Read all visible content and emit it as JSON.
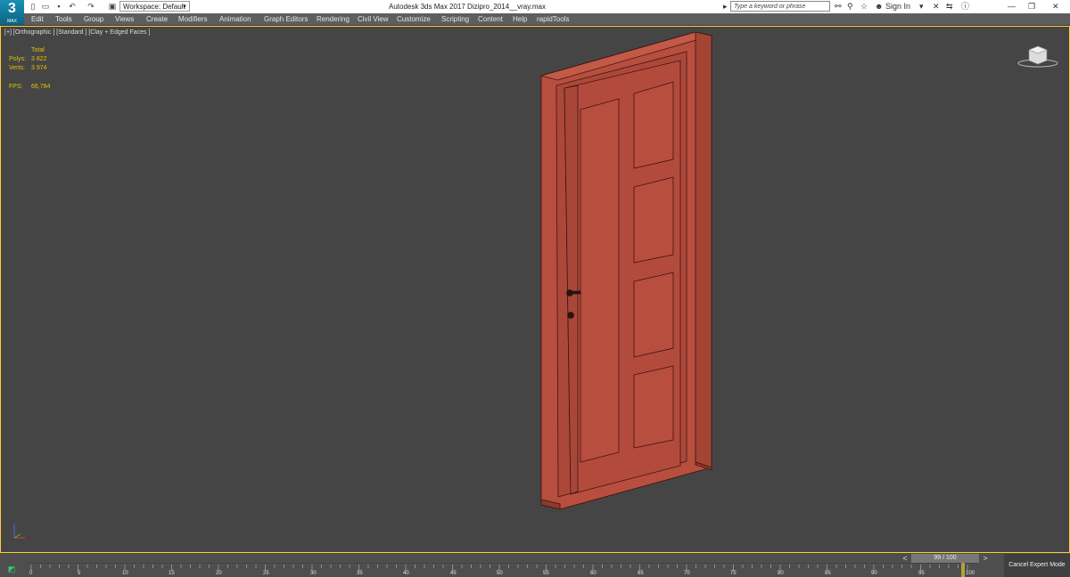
{
  "app": {
    "logo_text": "3",
    "logo_sub": "MAX"
  },
  "title_bar": {
    "title": "Autodesk 3ds Max 2017    Dizipro_2014__vray.max",
    "workspace_label": "Workspace: Default",
    "search_placeholder": "Type a keyword or phrase",
    "sign_in": "Sign In"
  },
  "menu": [
    "Edit",
    "Tools",
    "Group",
    "Views",
    "Create",
    "Modifiers",
    "Animation",
    "Graph Editors",
    "Rendering",
    "Civil View",
    "Customize",
    "Scripting",
    "Content",
    "Help",
    "rapidTools"
  ],
  "viewport": {
    "label": "[+] [Orthographic ] [Standard ] [Clay + Edged Faces ]",
    "stats": {
      "total_label": "Total",
      "polys_label": "Polys:",
      "polys_value": "3 822",
      "verts_label": "Verts:",
      "verts_value": "3 974",
      "fps_label": "FPS:",
      "fps_value": "66,784"
    },
    "door_color": "#b84e3e"
  },
  "timeline": {
    "slider_label": "99 / 100",
    "ticks": [
      "0",
      "5",
      "10",
      "15",
      "20",
      "25",
      "30",
      "35",
      "40",
      "45",
      "50",
      "55",
      "60",
      "65",
      "70",
      "75",
      "80",
      "85",
      "90",
      "95",
      "100"
    ],
    "cancel_expert": "Cancel Expert Mode"
  }
}
